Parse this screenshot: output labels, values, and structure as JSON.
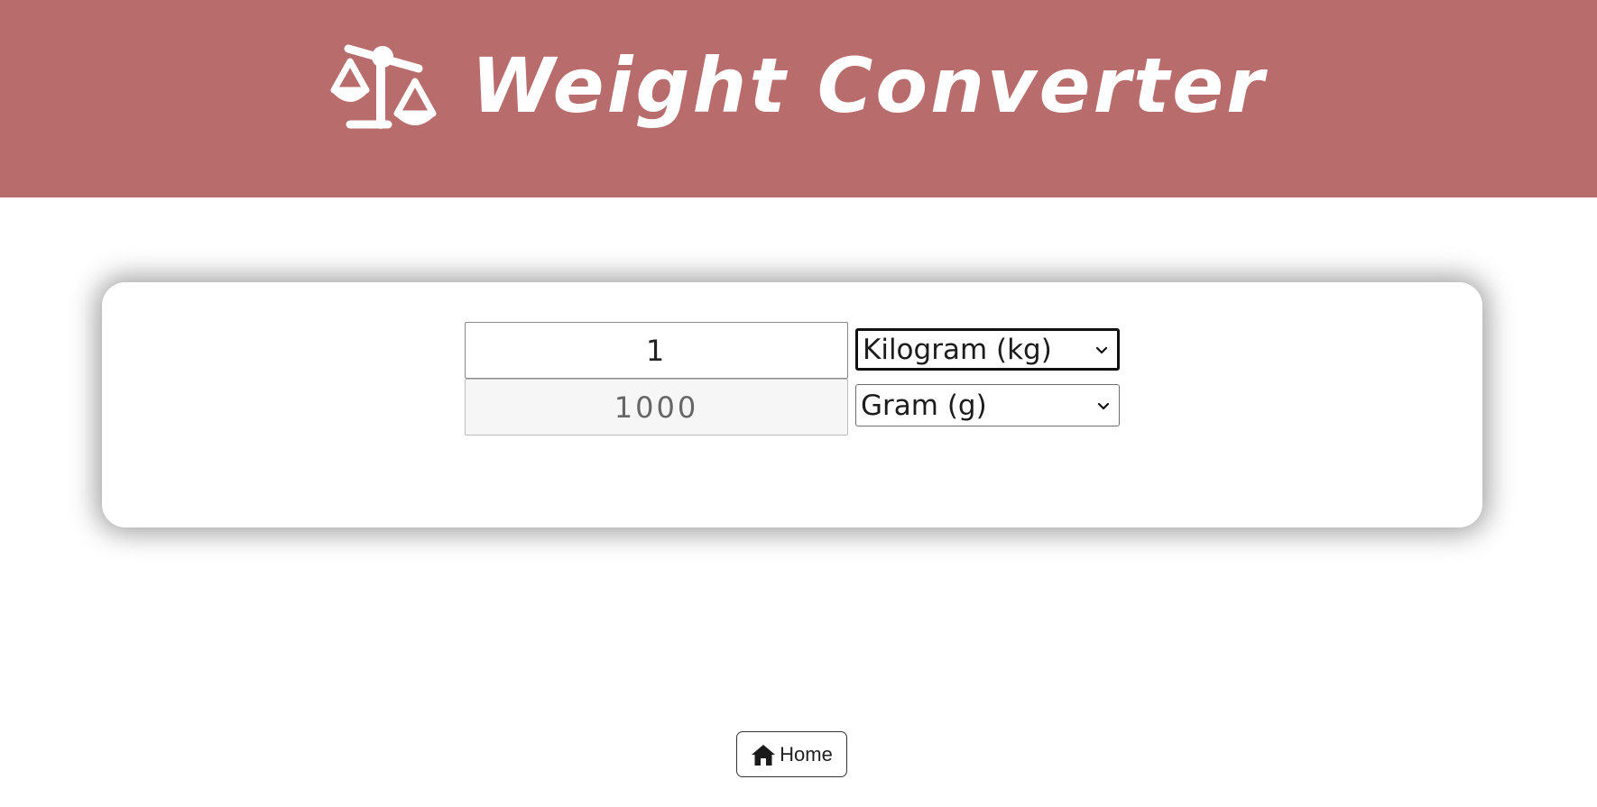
{
  "header": {
    "title": "Weight Converter",
    "icon": "scale-balance-icon",
    "background": "#b96c6c"
  },
  "converter": {
    "amount_value": "1",
    "result_value": "1000",
    "from_unit": "Kilogram (kg)",
    "to_unit": "Gram (g)"
  },
  "footer": {
    "home_label": "Home",
    "home_icon": "home-icon"
  }
}
